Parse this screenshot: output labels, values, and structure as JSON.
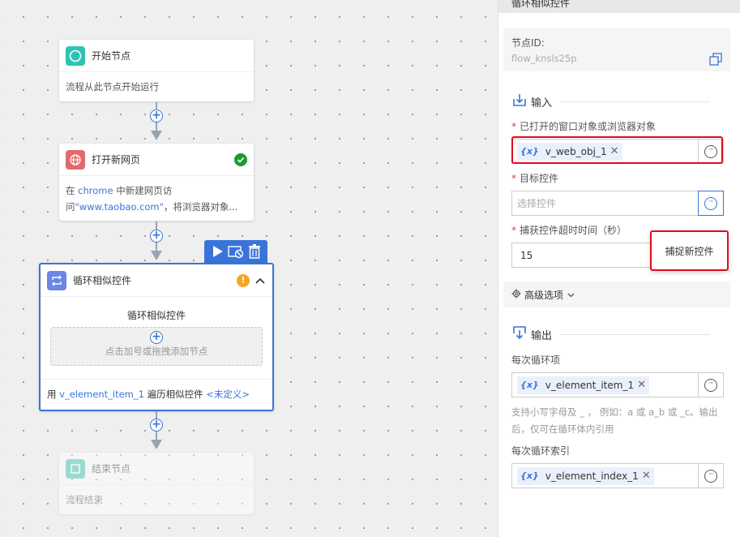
{
  "canvas": {
    "start_node": {
      "title": "开始节点",
      "desc": "流程从此节点开始运行"
    },
    "open_page_node": {
      "title": "打开新网页",
      "desc_prefix": "在 ",
      "desc_browser": "chrome",
      "desc_mid": " 中新建网页访",
      "desc_line2_prefix": "问",
      "desc_url": "\"www.taobao.com\"",
      "desc_line2_suffix": "，将浏览器对象..."
    },
    "loop_node": {
      "title": "循环相似控件",
      "inner_title": "循环相似控件",
      "drop_hint": "点击加号或拖拽添加节点",
      "footer_prefix": "用 ",
      "footer_var": "v_element_item_1",
      "footer_mid": " 遍历相似控件 ",
      "footer_undefined": "<未定义>"
    },
    "end_node": {
      "title": "结束节点",
      "desc": "流程结束"
    }
  },
  "panel": {
    "header": "循环相似控件",
    "node_id_label": "节点ID:",
    "node_id_value": "flow_knsls25p",
    "input_section": "输入",
    "field1_label": "已打开的窗口对象或浏览器对象",
    "field1_value": "v_web_obj_1",
    "field2_label": "目标控件",
    "field2_placeholder": "选择控件",
    "field3_label": "捕获控件超时时间（秒）",
    "field3_value": "15",
    "capture_button": "捕捉新控件",
    "advanced": "高级选项",
    "output_section": "输出",
    "out1_label": "每次循环项",
    "out1_value": "v_element_item_1",
    "out_hint": "支持小写字母及 _ ， 例如：a 或 a_b 或 _c。输出后，仅可在循环体内引用",
    "out2_label": "每次循环索引",
    "out2_value": "v_element_index_1",
    "var_badge": "{x}"
  },
  "colors": {
    "accent": "#3a74d9",
    "highlight_red": "#e10b1f",
    "success": "#1a9b2f",
    "warning": "#f5a623"
  }
}
